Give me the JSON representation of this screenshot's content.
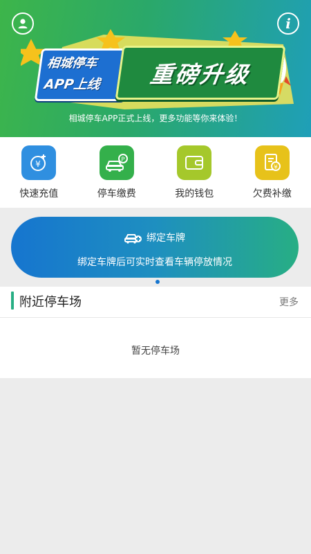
{
  "banner": {
    "badge_line1": "相城停车",
    "badge_line2": "APP上线",
    "headline": "重磅升级",
    "tagline": "相城停车APP正式上线，更多功能等你来体验！",
    "info_glyph": "i",
    "colors": {
      "gradient_start": "#3db54a",
      "gradient_end": "#1f9fb8"
    }
  },
  "quick_actions": [
    {
      "label": "快速充值",
      "icon": "yuan-recharge-icon",
      "color": "#2f8fe0"
    },
    {
      "label": "停车缴费",
      "icon": "car-parking-icon",
      "color": "#34b04b"
    },
    {
      "label": "我的钱包",
      "icon": "wallet-icon",
      "color": "#a5c82b"
    },
    {
      "label": "欠费补缴",
      "icon": "bill-icon",
      "color": "#e7c21a"
    }
  ],
  "bind_card": {
    "title": "绑定车牌",
    "subtitle": "绑定车牌后可实时查看车辆停放情况"
  },
  "nearby": {
    "title": "附近停车场",
    "more": "更多",
    "empty": "暂无停车场"
  }
}
